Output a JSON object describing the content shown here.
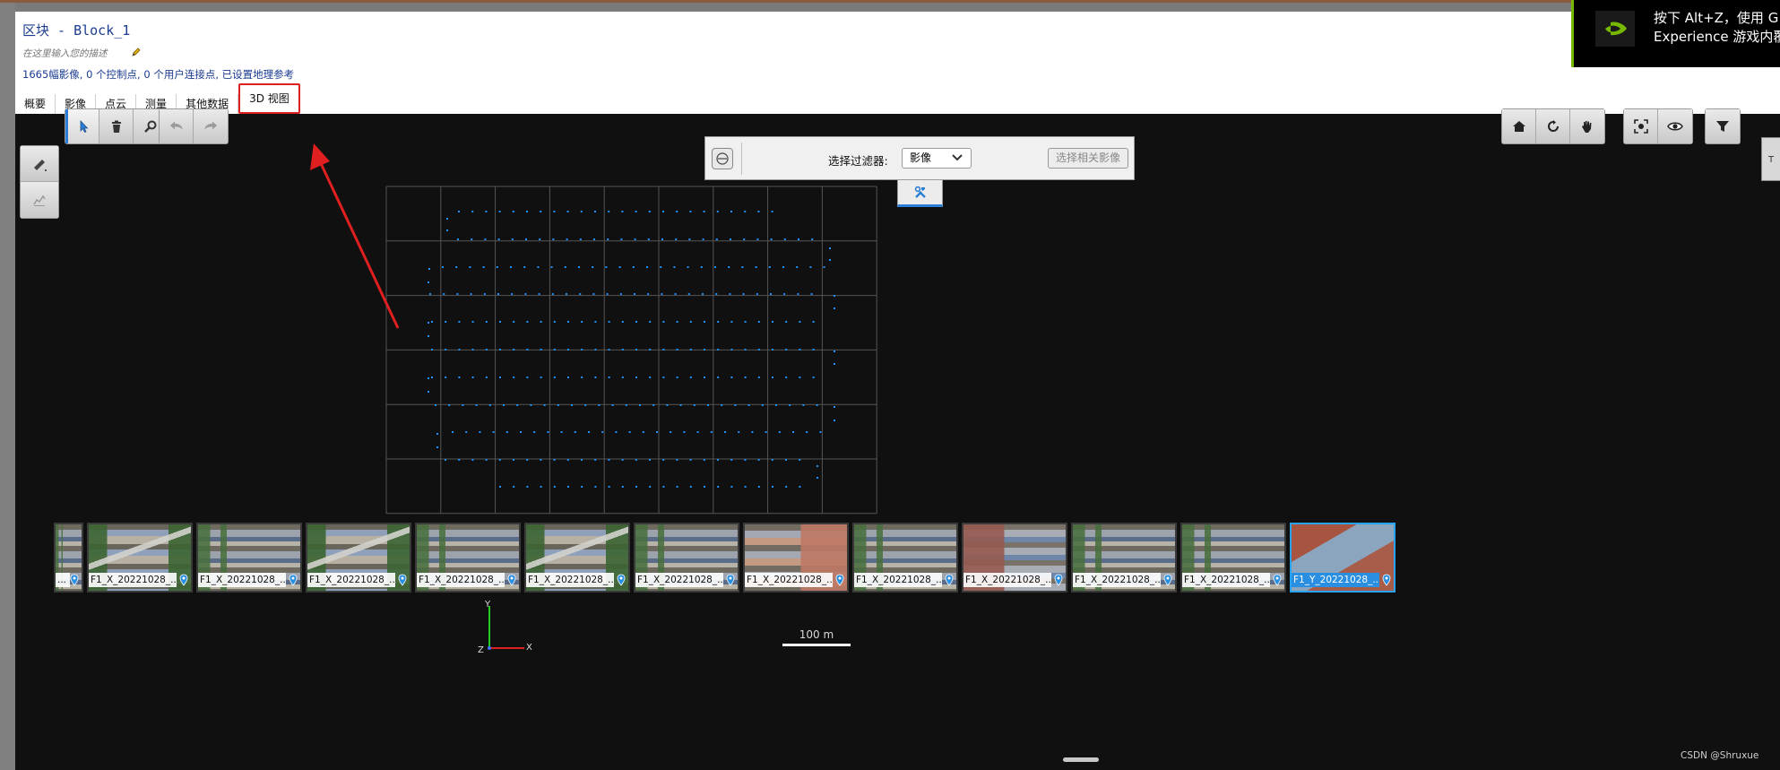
{
  "header": {
    "block_title": "区块 - Block_1",
    "description": "在这里输入您的描述",
    "info": "1665幅影像, 0 个控制点, 0 个用户连接点, 已设置地理参考"
  },
  "tabs": [
    {
      "label": "概要"
    },
    {
      "label": "影像"
    },
    {
      "label": "点云"
    },
    {
      "label": "测量"
    },
    {
      "label": "其他数据"
    },
    {
      "label": "3D 视图",
      "active": true
    }
  ],
  "filter": {
    "label": "选择过滤器:",
    "selected": "影像",
    "related_button": "选择相关影像"
  },
  "side_tab": "T",
  "scale": {
    "label": "100 m"
  },
  "axes": {
    "y": "Y",
    "x": "X",
    "z": "Z"
  },
  "thumbnails": [
    {
      "label": "..."
    },
    {
      "label": "F1_X_20221028_..."
    },
    {
      "label": "F1_X_20221028_..."
    },
    {
      "label": "F1_X_20221028_..."
    },
    {
      "label": "F1_X_20221028_..."
    },
    {
      "label": "F1_X_20221028_..."
    },
    {
      "label": "F1_X_20221028_..."
    },
    {
      "label": "F1_X_20221028_..."
    },
    {
      "label": "F1_X_20221028_..."
    },
    {
      "label": "F1_X_20221028_..."
    },
    {
      "label": "F1_X_20221028_..."
    },
    {
      "label": "F1_X_20221028_..."
    },
    {
      "label": "F1_Y_20221028_...",
      "selected": true
    }
  ],
  "toast": {
    "line1": "按下 Alt+Z，使用 G",
    "line2": "Experience 游戏内覆"
  },
  "watermark": "CSDN @Shruxue",
  "colors": {
    "accent_blue": "#2a7fd4",
    "annotation_red": "#e02020",
    "camera_point": "#1e90ff",
    "nvidia_green": "#76b900"
  }
}
